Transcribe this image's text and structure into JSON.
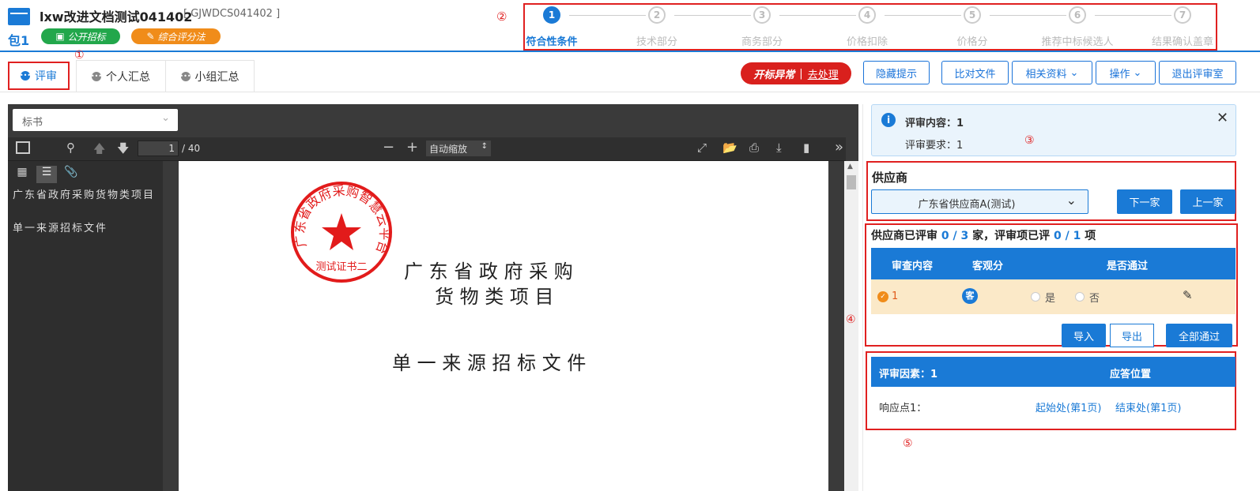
{
  "header": {
    "title": "lxw改进文档测试041402",
    "code": "[ GJWDCS041402 ]",
    "package": "包1",
    "badge_open": "公开招标",
    "badge_method": "综合评分法"
  },
  "steps": [
    {
      "num": "1",
      "label": "符合性条件",
      "active": true
    },
    {
      "num": "2",
      "label": "技术部分"
    },
    {
      "num": "3",
      "label": "商务部分"
    },
    {
      "num": "4",
      "label": "价格扣除"
    },
    {
      "num": "5",
      "label": "价格分"
    },
    {
      "num": "6",
      "label": "推荐中标候选人"
    },
    {
      "num": "7",
      "label": "结果确认盖章"
    }
  ],
  "annotations": {
    "a1": "①",
    "a2": "②",
    "a3": "③",
    "a4": "④",
    "a5": "⑤"
  },
  "tabs": {
    "review": "评审",
    "personal": "个人汇总",
    "group": "小组汇总"
  },
  "toolbar": {
    "alert_label": "开标异常",
    "alert_action": "去处理",
    "hide_tips": "隐藏提示",
    "compare": "比对文件",
    "related": "相关资料",
    "operate": "操作",
    "exit": "退出评审室"
  },
  "viewer": {
    "doc_select": "标书",
    "page_current": "1",
    "page_total": "/ 40",
    "zoom": "自动缩放",
    "outline": [
      "广东省政府采购货物类项目",
      "单一来源招标文件"
    ],
    "doc_title_1": "广 东 省 政 府 采 购",
    "doc_title_2": "货 物 类 项 目",
    "doc_subtitle": "单 一 来 源 招 标 文 件",
    "stamp_text": "广东省政府采购智慧云平台",
    "stamp_bottom": "测试证书二"
  },
  "info": {
    "content_label": "评审内容：1",
    "requirement_label": "评审要求：1"
  },
  "supplier": {
    "heading": "供应商",
    "selected": "广东省供应商A(测试)",
    "next": "下一家",
    "prev": "上一家"
  },
  "progress": {
    "prefix": "供应商已评审",
    "done": "0",
    "sep": "/",
    "total": "3",
    "unit": "家，评审项已评",
    "items_done": "0",
    "items_total": "1",
    "items_unit": "项"
  },
  "review_table": {
    "headers": [
      "审查内容",
      "客观分",
      "是否通过"
    ],
    "row": {
      "content": "1",
      "type": "客",
      "yes": "是",
      "no": "否"
    }
  },
  "actions": {
    "import": "导入",
    "export": "导出",
    "pass_all": "全部通过"
  },
  "factors": {
    "header_left": "评审因素：1",
    "header_right": "应答位置",
    "point_label": "响应点1：",
    "start": "起始处(第1页)",
    "end": "结束处(第1页)"
  },
  "colors": {
    "primary": "#1a7ad6",
    "badge_green": "#22a74b",
    "badge_orange": "#f08c1a",
    "alert_red": "#d9201d",
    "highlight": "#fbe9c8"
  }
}
